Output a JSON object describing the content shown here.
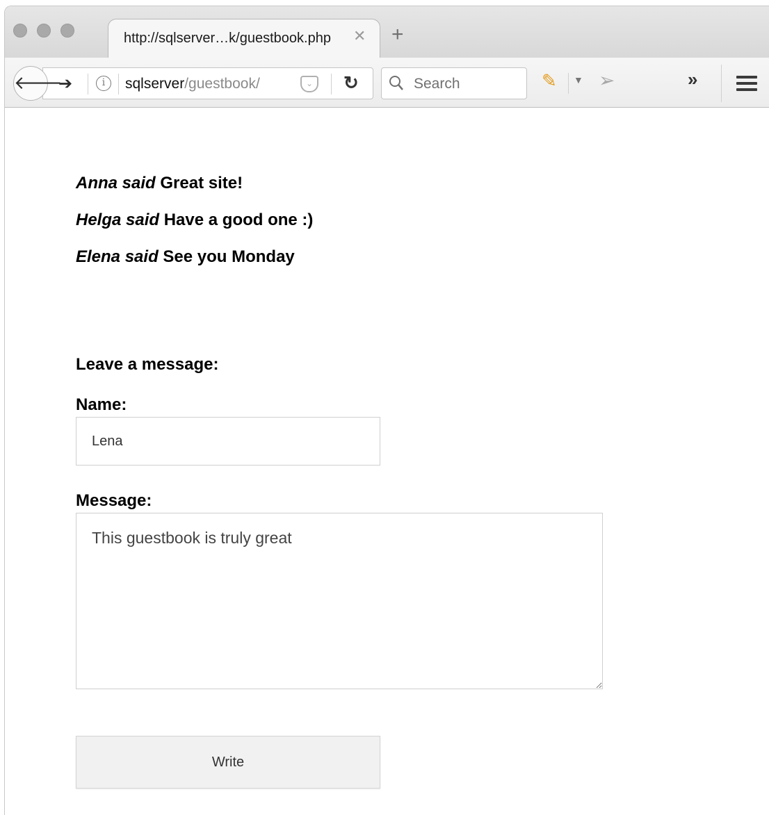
{
  "browser": {
    "tab_title": "http://sqlserver…k/guestbook.php",
    "tab_close_glyph": "✕",
    "new_tab_glyph": "+",
    "url_host": "sqlserver",
    "url_path": "/guestbook/",
    "search_placeholder": "Search",
    "overflow_glyph": "»",
    "icons": [
      "back-icon",
      "forward-icon",
      "info-icon",
      "pocket-icon",
      "reload-icon",
      "search-icon",
      "pencil-icon",
      "dropdown-icon",
      "send-icon",
      "overflow-icon",
      "menu-icon"
    ],
    "traffic_light_color": "#a9a9a9"
  },
  "guestbook": {
    "entries": [
      {
        "author": "Anna said",
        "message": "Great site!"
      },
      {
        "author": "Helga said",
        "message": "Have a good one :)"
      },
      {
        "author": "Elena said",
        "message": "See you Monday"
      }
    ]
  },
  "form": {
    "heading": "Leave a message:",
    "name_label": "Name:",
    "name_value": "Lena",
    "message_label": "Message:",
    "message_value": "This guestbook is truly great",
    "submit_label": "Write"
  }
}
